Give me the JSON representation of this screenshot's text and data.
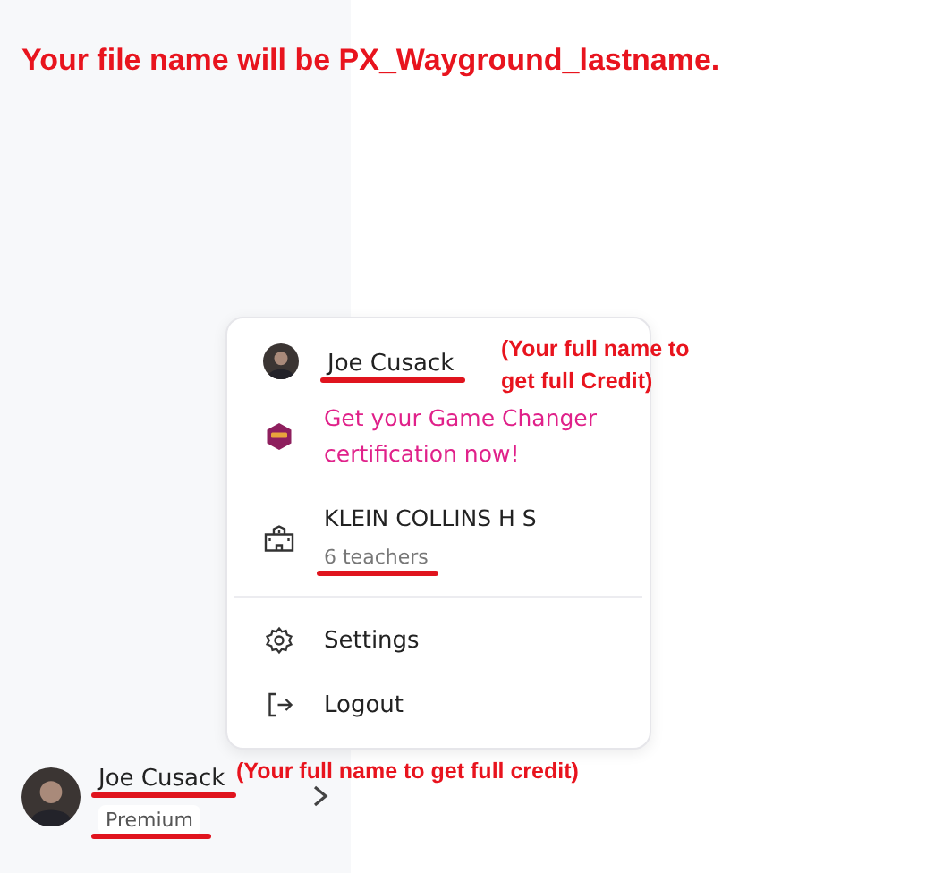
{
  "annotations": {
    "file_name_note": "Your file name will be PX_Wayground_lastname.",
    "menu_name_note": "(Your full name to get full Credit)",
    "profile_name_note": "(Your full name to get full credit)"
  },
  "menu": {
    "user": {
      "name": "Joe Cusack",
      "scribbled": true
    },
    "promo": "Get your Game Changer certification now!",
    "school": {
      "name": "KLEIN COLLINS H S",
      "detail": "6 teachers",
      "scribbled": true
    },
    "actions": [
      {
        "kind": "settings",
        "label": "Settings"
      },
      {
        "kind": "logout",
        "label": "Logout"
      }
    ]
  },
  "profile": {
    "name": "Joe Cusack",
    "name_scribbled": true,
    "plan": "Premium",
    "plan_scribbled": true
  }
}
